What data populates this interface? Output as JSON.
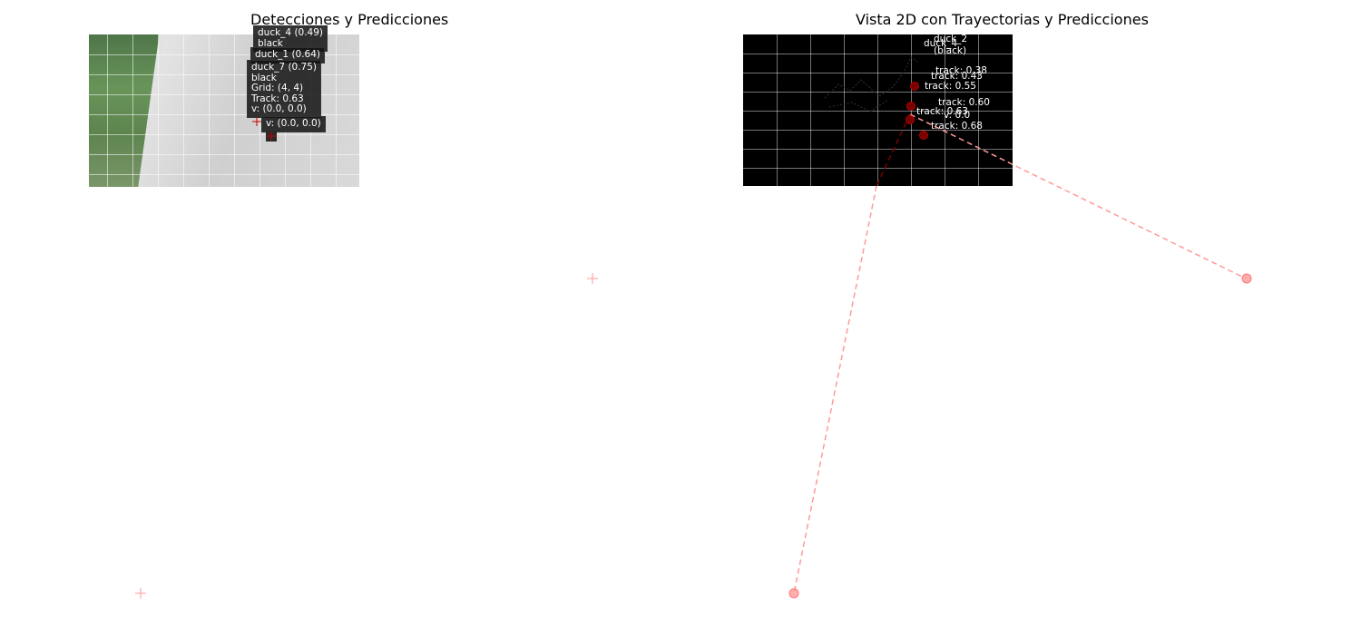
{
  "left_plot": {
    "title": "Detecciones y Predicciones",
    "labels": [
      {
        "text": "duck_4 (0.49)\nblack"
      },
      {
        "text": "duck_1 (0.64)"
      },
      {
        "text": "duck_7 (0.75)\nblack\nGrid: (4, 4)\nTrack: 0.63\nv: (0.0, 0.0)"
      },
      {
        "text": "v: (0.0, 0.0)"
      }
    ],
    "colors": {
      "marker": "#ff9999",
      "label_bg": "#141414"
    }
  },
  "right_plot": {
    "title": "Vista 2D con Trayectorias y Predicciones",
    "labels": [
      {
        "text": "duck_2"
      },
      {
        "text": "duck_4"
      },
      {
        "text": "(black)"
      },
      {
        "text": "track: 0.38"
      },
      {
        "text": "track: 0.43"
      },
      {
        "text": "track: 0.55"
      },
      {
        "text": "track: 0.60"
      },
      {
        "text": "track: 0.63"
      },
      {
        "text": "v: 0.0"
      },
      {
        "text": "track: 0.68"
      }
    ],
    "colors": {
      "background": "#000000",
      "trajectory": "#ff9999"
    }
  }
}
